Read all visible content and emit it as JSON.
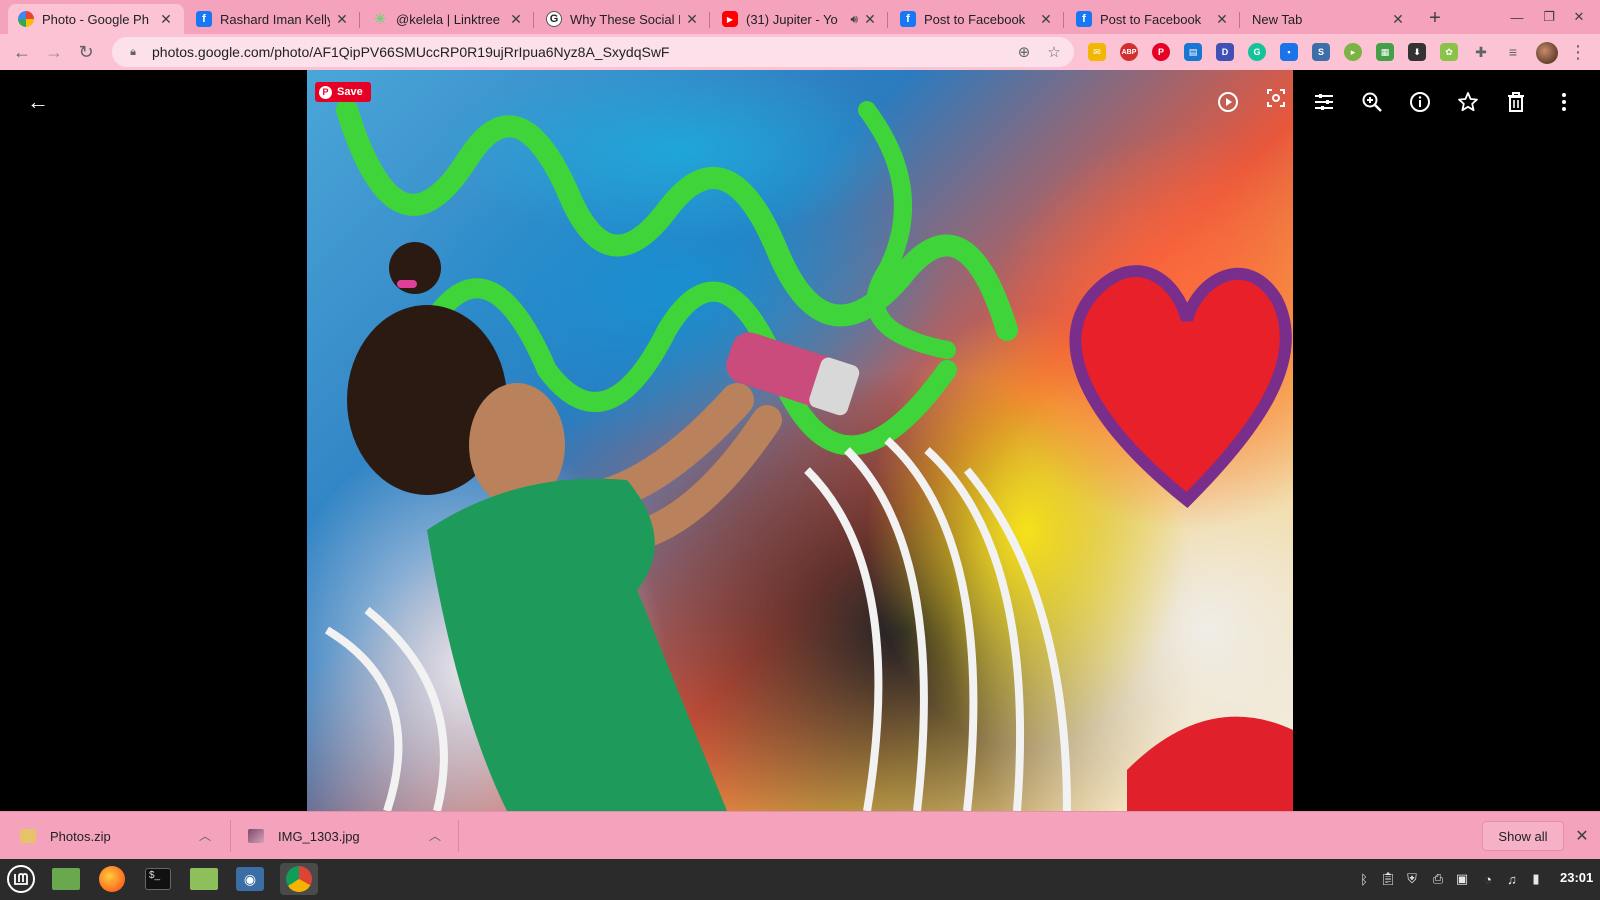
{
  "browser": {
    "tabs": [
      {
        "title": "Photo - Google Ph",
        "favicon": "google-photos-icon",
        "active": true
      },
      {
        "title": "Rashard Iman Kelly",
        "favicon": "facebook-icon"
      },
      {
        "title": "@kelela | Linktree",
        "favicon": "linktree-icon"
      },
      {
        "title": "Why These Social N",
        "favicon": "g-icon"
      },
      {
        "title": "(31) Jupiter - Yo",
        "favicon": "youtube-icon",
        "audio": true
      },
      {
        "title": "Post to Facebook",
        "favicon": "facebook-icon"
      },
      {
        "title": "Post to Facebook",
        "favicon": "facebook-icon"
      },
      {
        "title": "New Tab",
        "favicon": ""
      }
    ],
    "address_bar": {
      "url": "photos.google.com/photo/AF1QipPV66SMUccRP0R19ujRrIpua6Nyz8A_SxydqSwF"
    },
    "extensions": [
      "abp-icon",
      "pinterest-icon",
      "grammarly-icon"
    ],
    "colors": {
      "theme": "#f5a3bd",
      "toolbar": "#fbc3d4"
    }
  },
  "viewer": {
    "pinterest_save_label": "Save",
    "actions": [
      "play-slideshow-icon",
      "lens-icon",
      "edit-icon",
      "zoom-icon",
      "info-icon",
      "favorite-icon",
      "delete-icon",
      "more-options-icon"
    ]
  },
  "downloads": {
    "items": [
      {
        "name": "Photos.zip"
      },
      {
        "name": "IMG_1303.jpg"
      }
    ],
    "show_all_label": "Show all"
  },
  "taskbar": {
    "clock": "23:01"
  }
}
